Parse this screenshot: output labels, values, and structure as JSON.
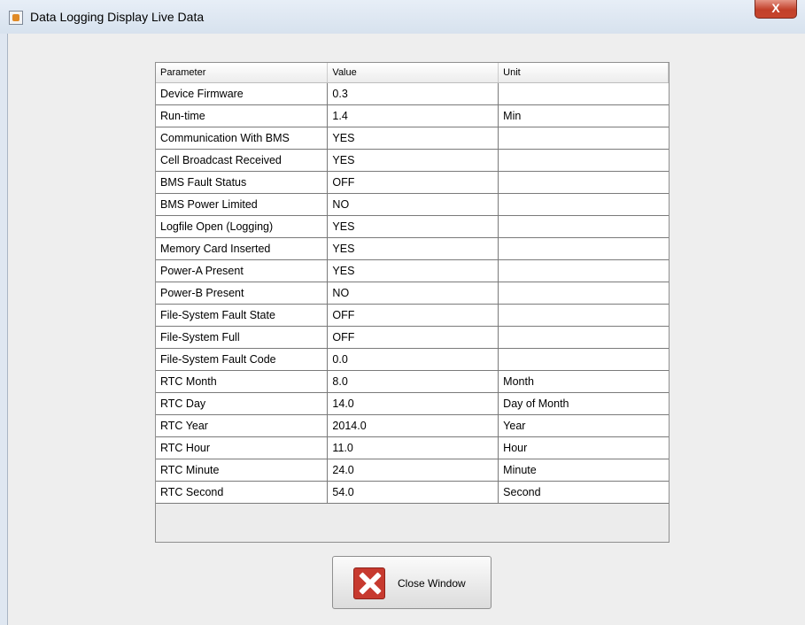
{
  "window": {
    "title": "Data Logging Display Live Data",
    "close_glyph": "X",
    "icon": "java-cup-icon"
  },
  "table": {
    "columns": [
      "Parameter",
      "Value",
      "Unit"
    ],
    "rows": [
      [
        "Device Firmware",
        "0.3",
        ""
      ],
      [
        "Run-time",
        "1.4",
        "Min"
      ],
      [
        "Communication With BMS",
        "YES",
        ""
      ],
      [
        "Cell Broadcast Received",
        "YES",
        ""
      ],
      [
        "BMS Fault Status",
        "OFF",
        ""
      ],
      [
        "BMS Power Limited",
        "NO",
        ""
      ],
      [
        "Logfile Open (Logging)",
        "YES",
        ""
      ],
      [
        "Memory Card Inserted",
        "YES",
        ""
      ],
      [
        "Power-A Present",
        "YES",
        ""
      ],
      [
        "Power-B Present",
        "NO",
        ""
      ],
      [
        "File-System Fault State",
        "OFF",
        ""
      ],
      [
        "File-System Full",
        "OFF",
        ""
      ],
      [
        "File-System Fault Code",
        "0.0",
        ""
      ],
      [
        "RTC Month",
        "8.0",
        "Month"
      ],
      [
        "RTC Day",
        "14.0",
        "Day of Month"
      ],
      [
        "RTC Year",
        "2014.0",
        "Year"
      ],
      [
        "RTC Hour",
        "11.0",
        "Hour"
      ],
      [
        "RTC Minute",
        "24.0",
        "Minute"
      ],
      [
        "RTC Second",
        "54.0",
        "Second"
      ]
    ]
  },
  "close_button": {
    "label": "Close Window",
    "icon": "close-x-icon"
  }
}
